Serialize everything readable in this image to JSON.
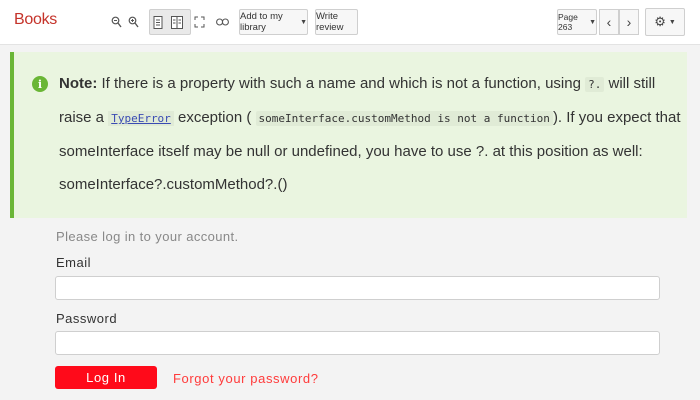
{
  "toolbar": {
    "brand": "Books",
    "zoom_out_icon": "zoom-out-icon",
    "zoom_in_icon": "zoom-in-icon",
    "add_to_library_label": "Add to my library",
    "write_review_label": "Write review",
    "page_label": "Page 263",
    "prev_icon": "chevron-left-icon",
    "next_icon": "chevron-right-icon",
    "settings_icon": "gear-icon"
  },
  "note": {
    "title": "Note:",
    "text_1": " If there is a property with such a name and which is not a function, using ",
    "code_1": "?.",
    "text_2": " will still raise a ",
    "code_link": "TypeError",
    "text_3": " exception (",
    "code_2": "someInterface.customMethod is not a function",
    "text_4": "). If you expect that someInterface itself may be null or undefined, you have to use ?. at this position as well: someInterface?.customMethod?.()"
  },
  "login": {
    "intro": "Please log in to your account.",
    "email_label": "Email",
    "email_value": "",
    "password_label": "Password",
    "password_value": "",
    "login_button": "Log In",
    "forgot_link": "Forgot your password?"
  },
  "colors": {
    "brand": "#c5332a",
    "note_bg": "#eaf5e0",
    "note_accent": "#6ab636",
    "login_button": "#ff0a1a",
    "forgot_link": "#ff3b3b"
  }
}
